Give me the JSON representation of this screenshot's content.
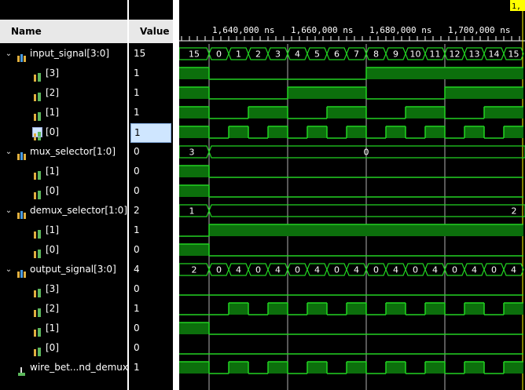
{
  "header": {
    "name_label": "Name",
    "value_label": "Value"
  },
  "cursor_label": "1,",
  "timeline": {
    "ticks": [
      "1,640,000 ns",
      "1,660,000 ns",
      "1,680,000 ns",
      "1,700,000 ns"
    ]
  },
  "signals": [
    {
      "name": "input_signal[3:0]",
      "value": "15",
      "kind": "bus",
      "expanded": true,
      "indent": 0,
      "icon": "bus-icon",
      "labels": [
        "15",
        "0",
        "1",
        "2",
        "3",
        "4",
        "5",
        "6",
        "7",
        "8",
        "9",
        "10",
        "11",
        "12",
        "13",
        "14",
        "15"
      ]
    },
    {
      "name": "[3]",
      "value": "1",
      "kind": "bit",
      "indent": 1,
      "icon": "bit-icon",
      "levels": [
        1,
        0,
        0,
        0,
        0,
        0,
        0,
        0,
        0,
        1,
        1,
        1,
        1,
        1,
        1,
        1,
        1
      ]
    },
    {
      "name": "[2]",
      "value": "1",
      "kind": "bit",
      "indent": 1,
      "icon": "bit-icon",
      "levels": [
        1,
        0,
        0,
        0,
        0,
        1,
        1,
        1,
        1,
        0,
        0,
        0,
        0,
        1,
        1,
        1,
        1
      ]
    },
    {
      "name": "[1]",
      "value": "1",
      "kind": "bit",
      "indent": 1,
      "icon": "bit-icon",
      "levels": [
        1,
        0,
        0,
        1,
        1,
        0,
        0,
        1,
        1,
        0,
        0,
        1,
        1,
        0,
        0,
        1,
        1
      ]
    },
    {
      "name": "[0]",
      "value": "1",
      "kind": "bit",
      "indent": 1,
      "icon": "bit-icon",
      "selected": true,
      "levels": [
        1,
        0,
        1,
        0,
        1,
        0,
        1,
        0,
        1,
        0,
        1,
        0,
        1,
        0,
        1,
        0,
        1
      ]
    },
    {
      "name": "mux_selector[1:0]",
      "value": "0",
      "kind": "bus-single",
      "expanded": true,
      "indent": 0,
      "icon": "bus-icon",
      "first_label": "3",
      "label": "0"
    },
    {
      "name": "[1]",
      "value": "0",
      "kind": "bit",
      "indent": 1,
      "icon": "bit-icon",
      "levels": [
        1,
        0,
        0,
        0,
        0,
        0,
        0,
        0,
        0,
        0,
        0,
        0,
        0,
        0,
        0,
        0,
        0
      ]
    },
    {
      "name": "[0]",
      "value": "0",
      "kind": "bit",
      "indent": 1,
      "icon": "bit-icon",
      "levels": [
        1,
        0,
        0,
        0,
        0,
        0,
        0,
        0,
        0,
        0,
        0,
        0,
        0,
        0,
        0,
        0,
        0
      ]
    },
    {
      "name": "demux_selector[1:0]",
      "value": "2",
      "kind": "bus-single",
      "expanded": true,
      "indent": 0,
      "icon": "bus-icon",
      "first_label": "1",
      "label": "2"
    },
    {
      "name": "[1]",
      "value": "1",
      "kind": "bit",
      "indent": 1,
      "icon": "bit-icon",
      "levels": [
        0,
        1,
        1,
        1,
        1,
        1,
        1,
        1,
        1,
        1,
        1,
        1,
        1,
        1,
        1,
        1,
        1
      ]
    },
    {
      "name": "[0]",
      "value": "0",
      "kind": "bit",
      "indent": 1,
      "icon": "bit-icon",
      "levels": [
        1,
        0,
        0,
        0,
        0,
        0,
        0,
        0,
        0,
        0,
        0,
        0,
        0,
        0,
        0,
        0,
        0
      ]
    },
    {
      "name": "output_signal[3:0]",
      "value": "4",
      "kind": "bus",
      "expanded": true,
      "indent": 0,
      "icon": "bus-icon",
      "labels": [
        "2",
        "0",
        "4",
        "0",
        "4",
        "0",
        "4",
        "0",
        "4",
        "0",
        "4",
        "0",
        "4",
        "0",
        "4",
        "0",
        "4"
      ]
    },
    {
      "name": "[3]",
      "value": "0",
      "kind": "bit",
      "indent": 1,
      "icon": "bit-icon",
      "levels": [
        0,
        0,
        0,
        0,
        0,
        0,
        0,
        0,
        0,
        0,
        0,
        0,
        0,
        0,
        0,
        0,
        0
      ]
    },
    {
      "name": "[2]",
      "value": "1",
      "kind": "bit",
      "indent": 1,
      "icon": "bit-icon",
      "levels": [
        0,
        0,
        1,
        0,
        1,
        0,
        1,
        0,
        1,
        0,
        1,
        0,
        1,
        0,
        1,
        0,
        1
      ]
    },
    {
      "name": "[1]",
      "value": "0",
      "kind": "bit",
      "indent": 1,
      "icon": "bit-icon",
      "levels": [
        1,
        0,
        0,
        0,
        0,
        0,
        0,
        0,
        0,
        0,
        0,
        0,
        0,
        0,
        0,
        0,
        0
      ]
    },
    {
      "name": "[0]",
      "value": "0",
      "kind": "bit",
      "indent": 1,
      "icon": "bit-icon",
      "levels": [
        0,
        0,
        0,
        0,
        0,
        0,
        0,
        0,
        0,
        0,
        0,
        0,
        0,
        0,
        0,
        0,
        0
      ]
    },
    {
      "name": "wire_bet...nd_demux",
      "value": "1",
      "kind": "bit",
      "indent": 0,
      "icon": "wire-icon",
      "levels": [
        1,
        0,
        1,
        0,
        1,
        0,
        1,
        0,
        1,
        0,
        1,
        0,
        1,
        0,
        1,
        0,
        1
      ]
    }
  ],
  "colors": {
    "wave": "#22d322",
    "fill": "#0c6f0c",
    "cursor": "#ffff00",
    "grid": "#d0d0d0"
  }
}
